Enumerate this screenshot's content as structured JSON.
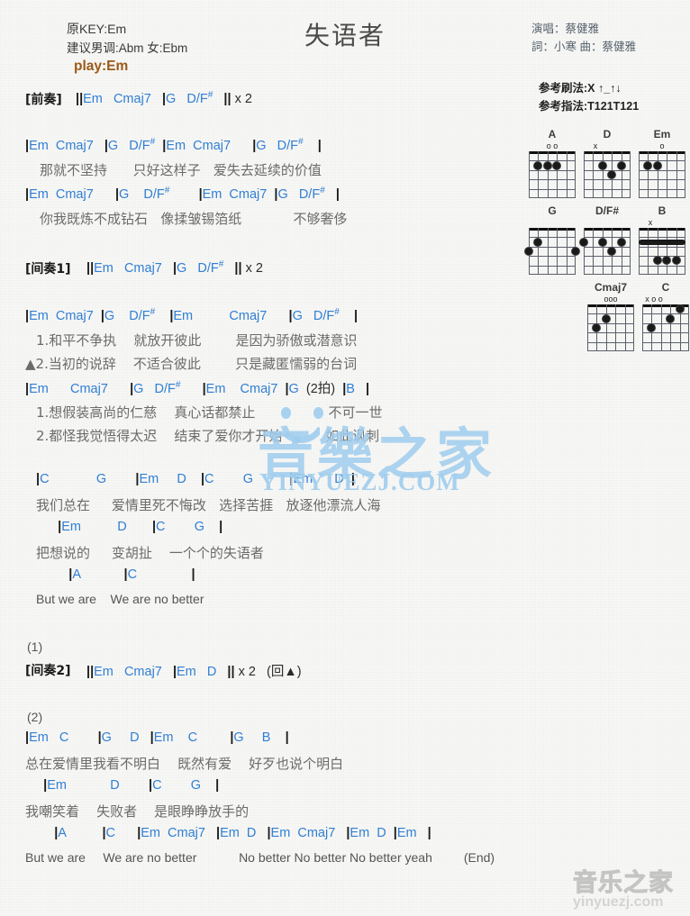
{
  "header": {
    "orig_key": "原KEY:Em",
    "suggest_key": "建议男调:Abm 女:Ebm",
    "play_key": "play:Em",
    "title": "失语者",
    "singer": "演唱：蔡健雅",
    "writers": "詞：小寒   曲：蔡健雅",
    "strum_ref": "参考刷法:X ↑_↑↓",
    "finger_ref": "参考指法:T121T121",
    "accent_chord": "#2f7fd4",
    "accent_play": "#9a5a18"
  },
  "chord_diagrams": [
    [
      {
        "name": "A",
        "markers": "o  o",
        "open": [
          "x:9",
          "x:43"
        ],
        "dots": [
          {
            "s": 2,
            "f": 2
          },
          {
            "s": 3,
            "f": 2
          },
          {
            "s": 4,
            "f": 2
          }
        ],
        "barre": null,
        "mute": null
      },
      {
        "name": "D",
        "markers": "x",
        "open": [],
        "dots": [
          {
            "s": 3,
            "f": 2
          },
          {
            "s": 4,
            "f": 3
          },
          {
            "s": 5,
            "f": 2
          }
        ],
        "barre": null,
        "mute": "x"
      },
      {
        "name": "Em",
        "markers": "o",
        "open": [
          "x:1"
        ],
        "dots": [
          {
            "s": 2,
            "f": 2
          },
          {
            "s": 3,
            "f": 2
          }
        ],
        "barre": null,
        "mute": null
      }
    ],
    [
      {
        "name": "G",
        "markers": "",
        "open": [],
        "dots": [
          {
            "s": 1,
            "f": 3
          },
          {
            "s": 2,
            "f": 2
          },
          {
            "s": 6,
            "f": 3
          }
        ],
        "barre": null,
        "mute": null
      },
      {
        "name": "D/F#",
        "markers": "",
        "open": [],
        "dots": [
          {
            "s": 1,
            "f": 2
          },
          {
            "s": 3,
            "f": 2
          },
          {
            "s": 4,
            "f": 3
          },
          {
            "s": 5,
            "f": 2
          }
        ],
        "barre": null,
        "mute": null
      },
      {
        "name": "B",
        "markers": "x",
        "open": [],
        "dots": [
          {
            "s": 3,
            "f": 4
          },
          {
            "s": 4,
            "f": 4
          },
          {
            "s": 5,
            "f": 4
          }
        ],
        "barre": {
          "f": 2,
          "from": 1,
          "to": 6
        },
        "mute": "x"
      }
    ],
    [
      {
        "name": "Cmaj7",
        "markers": "ooo",
        "open": [],
        "dots": [
          {
            "s": 2,
            "f": 3
          },
          {
            "s": 3,
            "f": 2
          }
        ],
        "barre": null,
        "mute": null
      },
      {
        "name": "C",
        "markers": "x  o  o",
        "open": [],
        "dots": [
          {
            "s": 2,
            "f": 3
          },
          {
            "s": 4,
            "f": 2
          },
          {
            "s": 5,
            "f": 1
          }
        ],
        "barre": null,
        "mute": "x"
      }
    ]
  ],
  "sheet": {
    "intro": {
      "tag": "[前奏]",
      "chords": "||Em   Cmaj7   |G   D/F#   || x 2"
    },
    "verse1": {
      "chord_line1": "|Em  Cmaj7   |G   D/F#  |Em  Cmaj7      |G   D/F#    |",
      "lyric_line1": "那就不坚持      只好这样子   爱失去延续的价值",
      "chord_line2": "|Em  Cmaj7      |G    D/F#        |Em  Cmaj7  |G   D/F#   |",
      "lyric_line2": "你我既炼不成钻石   像揉皱锡箔纸            不够奢侈"
    },
    "interlude1": {
      "tag": "[间奏1]",
      "chords": "||Em   Cmaj7   |G   D/F#   || x 2"
    },
    "verse2": {
      "chord_line1": "|Em  Cmaj7  |G    D/F#    |Em          Cmaj7      |G   D/F#    |",
      "lyric_line1": "1.和平不争执    就放开彼此        是因为骄傲或潜意识",
      "lyric_line2": "▲2.当初的说辞    不适合彼此        只是藏匿懦弱的台词",
      "chord_line2": "|Em      Cmaj7      |G   D/F#      |Em    Cmaj7  |G  (2拍)  |B   |",
      "lyric_line3": "1.想假装高尚的仁慈    真心话都禁止                 不可一世",
      "lyric_line4": "2.都怪我觉悟得太迟    结束了爱你才开始          如此讽刺"
    },
    "chorus": {
      "chord_line1": "|C             G        |Em     D    |C        G          |Em      D  |",
      "lyric_line1": "我们总在     爱情里死不悔改   选择苦捱   放逐他漂流人海",
      "chord_line2": "      |Em          D       |C        G    |",
      "lyric_line2": "把想说的     变胡扯    一个个的失语者",
      "chord_line3": "         |A            |C               |",
      "lyric_line3": "But we are    We are no better"
    },
    "repeat1": "(1)",
    "interlude2": {
      "tag": "[间奏2]",
      "chords": "||Em   Cmaj7   |Em   D   || x 2   (回▲)"
    },
    "repeat2": "(2)",
    "outro": {
      "chord_line1": "|Em   C        |G     D   |Em    C         |G     B    |",
      "lyric_line1": "总在爱情里我看不明白    既然有爱    好歹也说个明白",
      "chord_line2": "     |Em            D        |C        G    |",
      "lyric_line2": "我嘲笑着    失败者    是眼睁睁放手的",
      "chord_line3": "        |A          |C      |Em  Cmaj7   |Em  D   |Em  Cmaj7   |Em  D  |Em   |",
      "lyric_line3": "But we are     We are no better            No better No better No better yeah         (End)"
    }
  },
  "watermarks": {
    "center_cn": "音樂之家",
    "center_en": "YINYUEZJ.COM",
    "bottom_cn": "音乐之家",
    "bottom_en": "yinyuezj.com",
    "color": "#9fcdee"
  }
}
